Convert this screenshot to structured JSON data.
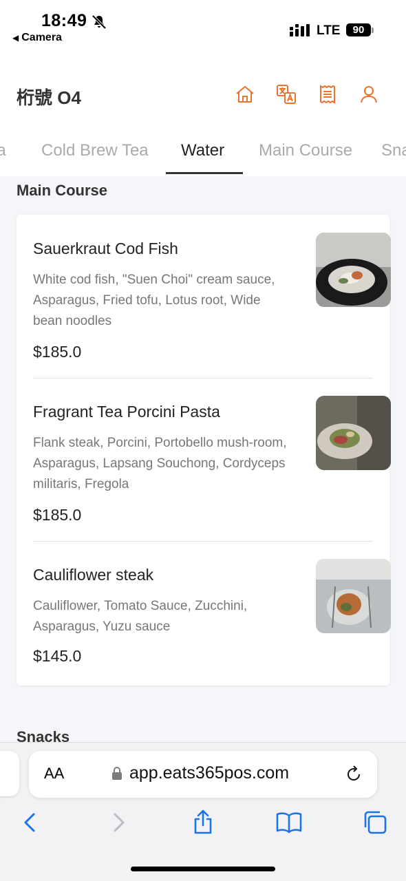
{
  "status_bar": {
    "time": "18:49",
    "back_app": "Camera",
    "network": "LTE",
    "battery": "90"
  },
  "header": {
    "store_title": "桁號 O4",
    "icons": [
      "home-icon",
      "translate-icon",
      "receipt-icon",
      "user-icon"
    ],
    "accent_color": "#e8742f"
  },
  "tabs": [
    {
      "label": "Tea"
    },
    {
      "label": "Cold Brew Tea"
    },
    {
      "label": "Water",
      "active": true
    },
    {
      "label": "Main Course"
    },
    {
      "label": "Snacks"
    }
  ],
  "section": {
    "title": "Main Course",
    "items": [
      {
        "name": "Sauerkraut Cod Fish",
        "description": "White cod fish, \"Suen Choi\" cream sauce, Asparagus, Fried tofu, Lotus root, Wide bean noodles",
        "price": "$185.0"
      },
      {
        "name": "Fragrant Tea Porcini Pasta",
        "description": "Flank steak, Porcini, Portobello mush-room, Asparagus, Lapsang Souchong, Cordyceps militaris, Fregola",
        "price": "$185.0"
      },
      {
        "name": "Cauliflower steak",
        "description": "Cauliflower, Tomato Sauce, Zucchini, Asparagus, Yuzu sauce",
        "price": "$145.0"
      }
    ]
  },
  "next_section": {
    "title": "Snacks"
  },
  "browser": {
    "text_size_label": "AA",
    "url": "app.eats365pos.com",
    "toolbar": [
      "back-icon",
      "forward-icon",
      "share-icon",
      "bookmarks-icon",
      "tabs-icon"
    ],
    "accent_color": "#1a73e8"
  }
}
